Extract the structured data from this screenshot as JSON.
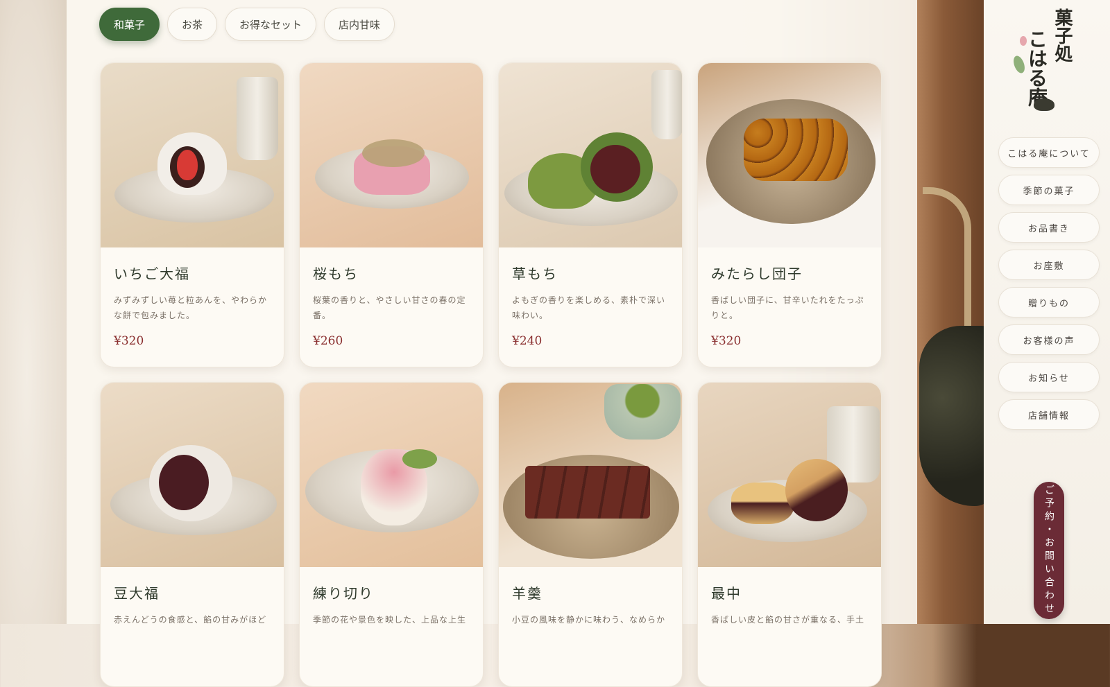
{
  "brand": {
    "logo_text_top": "菓子処",
    "logo_text_main": "こはる庵"
  },
  "category_tabs": [
    {
      "label": "和菓子",
      "active": true
    },
    {
      "label": "お茶",
      "active": false
    },
    {
      "label": "お得なセット",
      "active": false
    },
    {
      "label": "店内甘味",
      "active": false
    }
  ],
  "products": [
    {
      "name": "いちご大福",
      "desc": "みずみずしい苺と粒あんを、やわらかな餅で包みました。",
      "price": "¥320",
      "image": "strawberry-daifuku"
    },
    {
      "name": "桜もち",
      "desc": "桜葉の香りと、やさしい甘さの春の定番。",
      "price": "¥260",
      "image": "sakura-mochi"
    },
    {
      "name": "草もち",
      "desc": "よもぎの香りを楽しめる、素朴で深い味わい。",
      "price": "¥240",
      "image": "kusa-mochi"
    },
    {
      "name": "みたらし団子",
      "desc": "香ばしい団子に、甘辛いたれをたっぷりと。",
      "price": "¥320",
      "image": "mitarashi-dango"
    },
    {
      "name": "豆大福",
      "desc": "赤えんどうの食感と、餡の甘みがほど",
      "price": "",
      "image": "mame-daifuku"
    },
    {
      "name": "練り切り",
      "desc": "季節の花や景色を映した、上品な上生",
      "price": "",
      "image": "nerikiri"
    },
    {
      "name": "羊羹",
      "desc": "小豆の風味を静かに味わう、なめらか",
      "price": "",
      "image": "yokan"
    },
    {
      "name": "最中",
      "desc": "香ばしい皮と餡の甘さが重なる、手土",
      "price": "",
      "image": "monaka"
    }
  ],
  "sidebar_nav": [
    {
      "label": "こはる庵について"
    },
    {
      "label": "季節の菓子"
    },
    {
      "label": "お品書き"
    },
    {
      "label": "お座敷"
    },
    {
      "label": "贈りもの"
    },
    {
      "label": "お客様の声"
    },
    {
      "label": "お知らせ"
    },
    {
      "label": "店舗情報"
    }
  ],
  "reserve_button": {
    "label": "ご予約・お問い合わせ"
  },
  "colors": {
    "accent_green": "#3f6a3a",
    "price_red": "#8a2f2f",
    "reserve_bg": "#6b2b36"
  }
}
